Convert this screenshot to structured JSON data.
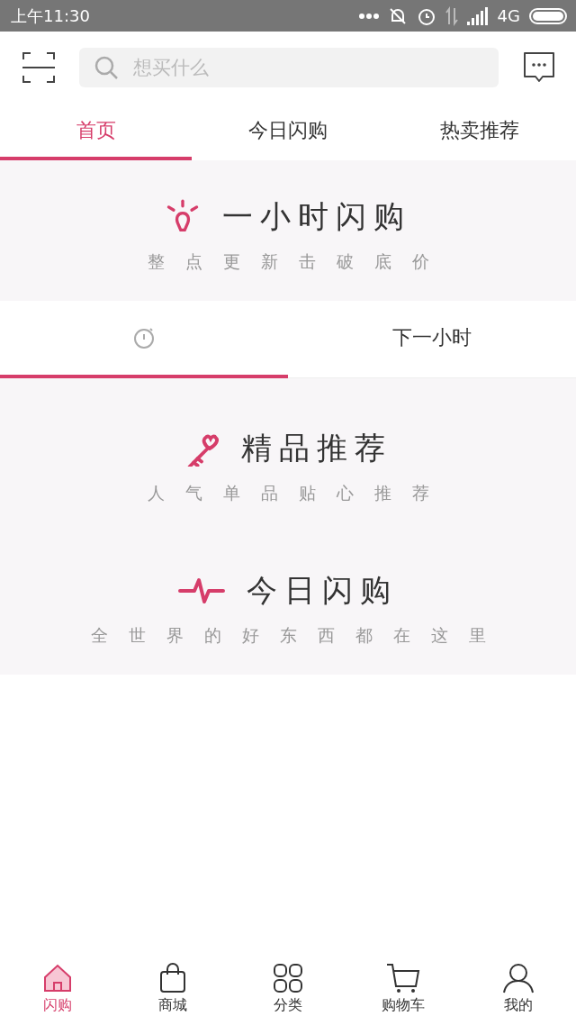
{
  "status_bar": {
    "time": "上午11:30",
    "network": "4G"
  },
  "search": {
    "placeholder": "想买什么"
  },
  "tabs": [
    {
      "label": "首页",
      "selected": true
    },
    {
      "label": "今日闪购",
      "selected": false
    },
    {
      "label": "热卖推荐",
      "selected": false
    }
  ],
  "flash_section": {
    "kind": "bulb",
    "title": "一小时闪购",
    "subtitle": "整点更新击破底价"
  },
  "time_tabs": [
    {
      "kind": "stopwatch",
      "selected": true
    },
    {
      "kind": "text",
      "label": "下一小时",
      "selected": false
    }
  ],
  "sections": [
    {
      "kind": "key",
      "title": "精品推荐",
      "subtitle": "人气单品贴心推荐"
    },
    {
      "kind": "pulse",
      "title": "今日闪购",
      "subtitle": "全世界的好东西都在这里"
    }
  ],
  "bottom_nav": [
    {
      "kind": "home",
      "label": "闪购",
      "selected": true
    },
    {
      "kind": "bag",
      "label": "商城",
      "selected": false
    },
    {
      "kind": "grid",
      "label": "分类",
      "selected": false
    },
    {
      "kind": "cart",
      "label": "购物车",
      "selected": false
    },
    {
      "kind": "person",
      "label": "我的",
      "selected": false
    }
  ]
}
